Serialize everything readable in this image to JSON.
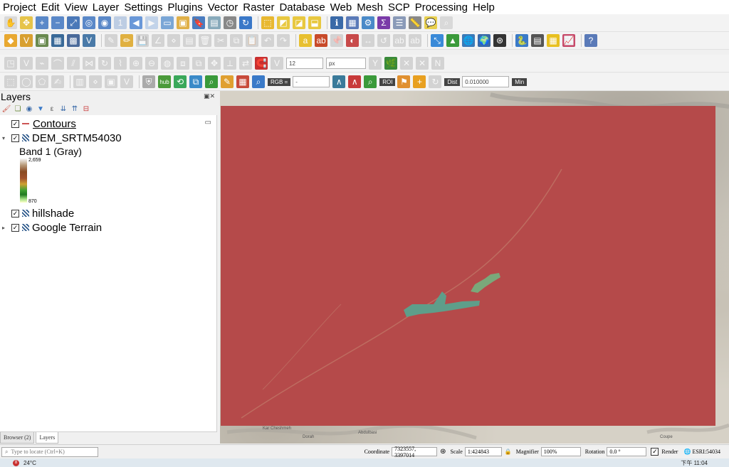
{
  "menu": [
    "Project",
    "Edit",
    "View",
    "Layer",
    "Settings",
    "Plugins",
    "Vector",
    "Raster",
    "Database",
    "Web",
    "Mesh",
    "SCP",
    "Processing",
    "Help"
  ],
  "toolbar": {
    "font_size_value": "12",
    "font_unit": "px",
    "rgb_label": "RGB =",
    "rgb_value": "-",
    "roi_label": "ROI",
    "dist_label": "Dist",
    "dist_value": "0.010000",
    "min_label": "Min",
    "hub_label": "hub"
  },
  "layers_panel": {
    "title": "Layers",
    "items": [
      {
        "name": "Contours",
        "checked": true,
        "type": "line"
      },
      {
        "name": "DEM_SRTM54030",
        "checked": true,
        "type": "raster",
        "expanded": true
      },
      {
        "name": "hillshade",
        "checked": true,
        "type": "raster"
      },
      {
        "name": "Google Terrain",
        "checked": true,
        "type": "raster"
      }
    ],
    "legend": {
      "band_label": "Band 1 (Gray)",
      "max": "2,659",
      "min": "870"
    },
    "tabs": [
      "Browser (2)",
      "Layers"
    ]
  },
  "map_labels": [
    "Kar Cheshmeh",
    "Abdulbasi",
    "Dorah",
    "Coupe"
  ],
  "statusbar": {
    "locate_placeholder": "Type to locate (Ctrl+K)",
    "coordinate_label": "Coordinate",
    "coordinate_value": "7323557, 3397014",
    "scale_label": "Scale",
    "scale_value": "1:424843",
    "magnifier_label": "Magnifier",
    "magnifier_value": "100%",
    "rotation_label": "Rotation",
    "rotation_value": "0.0 °",
    "render_label": "Render",
    "crs_label": "ESRI:54034"
  },
  "taskbar": {
    "temperature": "24°C",
    "notification_count": "8",
    "clock": "下午 11:04"
  },
  "colors": {
    "dem_overlay": "#b54a4a",
    "river_polygon": "#5e9e8a",
    "accent_green": "#3a9a3a"
  }
}
